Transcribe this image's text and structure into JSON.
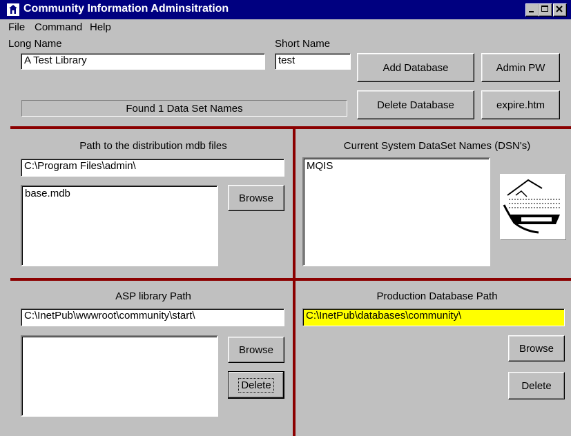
{
  "window": {
    "title": "Community Information Adminsitration"
  },
  "menu": {
    "items": [
      "File",
      "Command",
      "Help"
    ]
  },
  "top": {
    "long_name_label": "Long Name",
    "long_name_value": "A Test Library",
    "short_name_label": "Short Name",
    "short_name_value": "test",
    "status_text": "Found 1 Data Set Names",
    "add_database_label": "Add Database",
    "delete_database_label": "Delete Database",
    "admin_pw_label": "Admin PW",
    "expire_label": "expire.htm"
  },
  "distribution": {
    "heading": "Path to the distribution  mdb files",
    "path_value": "C:\\Program Files\\admin\\",
    "files": [
      "base.mdb"
    ],
    "browse_label": "Browse"
  },
  "dsn": {
    "heading": "Current System DataSet Names (DSN's)",
    "names": [
      "MQIS"
    ]
  },
  "asp": {
    "heading": "ASP library Path",
    "path_value": "C:\\InetPub\\wwwroot\\community\\start\\",
    "browse_label": "Browse",
    "delete_label": "Delete"
  },
  "production": {
    "heading": "Production Database Path",
    "path_value": "C:\\InetPub\\databases\\community\\",
    "browse_label": "Browse",
    "delete_label": "Delete",
    "highlight_color": "#ffff00"
  },
  "colors": {
    "titlebar": "#000080",
    "divider": "#8b0000",
    "window_bg": "#c0c0c0"
  },
  "icons": {
    "app": "app-icon",
    "logo": "community-information-logo"
  }
}
